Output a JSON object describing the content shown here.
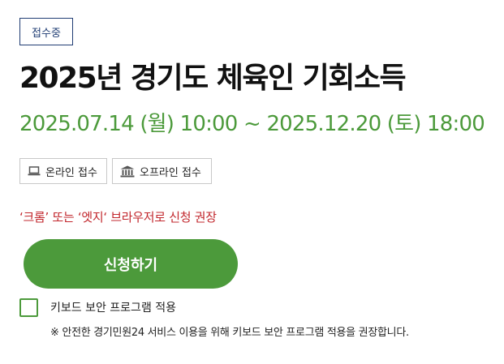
{
  "status": {
    "badge_label": "접수중"
  },
  "program": {
    "title": "2025년 경기도 체육인 기회소득",
    "period": "2025.07.14 (월) 10:00 ~ 2025.12.20 (토) 18:00"
  },
  "methods": [
    {
      "icon": "laptop-icon",
      "label": "온라인 접수"
    },
    {
      "icon": "building-icon",
      "label": "오프라인 접수"
    }
  ],
  "notice": {
    "browser": "‘크롬’ 또는 ‘엣지‘ 브라우저로 신청 권장"
  },
  "actions": {
    "apply_label": "신청하기"
  },
  "keyboard_security": {
    "checked": false,
    "label": "키보드 보안 프로그램 적용",
    "note": "※ 안전한 경기민원24 서비스 이용을 위해 키보드 보안 프로그램 적용을 권장합니다."
  },
  "colors": {
    "accent_green": "#4c9a3b",
    "badge_navy": "#1f3c73",
    "notice_red": "#c2272d"
  }
}
